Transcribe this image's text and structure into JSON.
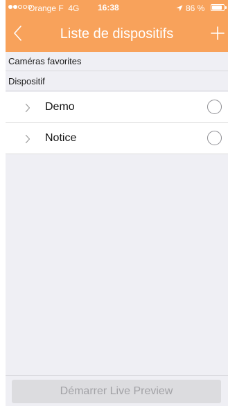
{
  "status_bar": {
    "carrier": "Orange F",
    "network": "4G",
    "time": "16:38",
    "battery_percent": "86 %",
    "signal_bars_filled": 2,
    "signal_bars_total": 5,
    "icons": [
      "location-arrow-icon",
      "battery-icon"
    ]
  },
  "nav": {
    "title": "Liste de dispositifs",
    "back_icon": "chevron-left-icon",
    "add_icon": "plus-icon"
  },
  "sections": {
    "favorites_label": "Caméras favorites",
    "devices_label": "Dispositif"
  },
  "devices": [
    {
      "name": "Demo",
      "selected": false
    },
    {
      "name": "Notice",
      "selected": false
    }
  ],
  "footer": {
    "live_preview_label": "Démarrer Live Preview"
  },
  "colors": {
    "accent": "#f8a25b",
    "background": "#efeff4",
    "row_background": "#ffffff",
    "disabled_button": "#dcdcdf",
    "disabled_text": "#a2a2a6"
  }
}
